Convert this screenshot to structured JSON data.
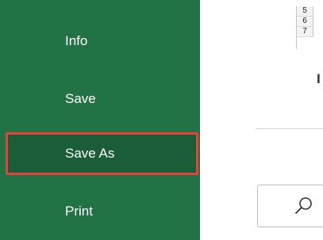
{
  "sidebar": {
    "items": [
      {
        "label": "Info"
      },
      {
        "label": "Save"
      },
      {
        "label": "Save As",
        "selected": true
      },
      {
        "label": "Print"
      }
    ],
    "background_color": "#217346",
    "highlight_color": "#e8403a"
  },
  "sheet_preview": {
    "rows": [
      "5",
      "6",
      "7"
    ]
  },
  "content": {
    "truncated_text": "I"
  },
  "search": {
    "icon": "search-icon"
  }
}
